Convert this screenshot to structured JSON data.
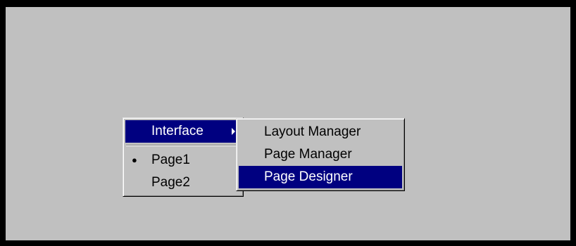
{
  "main_menu": {
    "items": [
      {
        "label": "Interface",
        "selected": true,
        "has_submenu": true,
        "arrow_icon": "submenu-arrow-icon"
      },
      {
        "label": "Page1",
        "checked": true,
        "bullet_icon": "radio-bullet-icon",
        "bullet": "●"
      },
      {
        "label": "Page2",
        "checked": false
      }
    ]
  },
  "sub_menu": {
    "items": [
      {
        "label": "Layout Manager",
        "selected": false
      },
      {
        "label": "Page Manager",
        "selected": false
      },
      {
        "label": "Page Designer",
        "selected": true
      }
    ]
  },
  "colors": {
    "face": "#c0c0c0",
    "highlight": "#000080",
    "highlight_text": "#ffffff",
    "frame": "#000000"
  }
}
